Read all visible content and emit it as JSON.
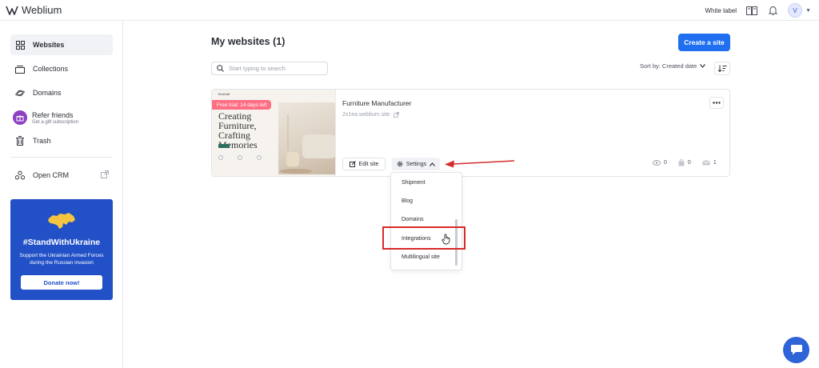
{
  "app": {
    "logo_text": "Weblium"
  },
  "topbar": {
    "white_label": "White label",
    "avatar_initial": "V"
  },
  "sidebar": {
    "items": [
      {
        "label": "Websites",
        "icon": "grid-icon",
        "active": true
      },
      {
        "label": "Collections",
        "icon": "stack-icon"
      },
      {
        "label": "Domains",
        "icon": "planet-icon"
      }
    ],
    "refer": {
      "title": "Refer friends",
      "subtitle": "Get a gift subscription"
    },
    "trash": "Trash",
    "crm": "Open CRM",
    "ukraine": {
      "tag": "#StandWithUkraine",
      "desc": "Support the Ukrainian Armed Forces during the Russian invasion",
      "donate": "Donate now!"
    }
  },
  "main": {
    "title": "My websites (1)",
    "create_button": "Create a site",
    "search_placeholder": "Start typing to search",
    "sort_label": "Sort by: Created date"
  },
  "card": {
    "thumbnail": {
      "brand": "ErraCraft",
      "trial_badge": "Free trial: 14 days left",
      "hero_text": "Creating Furniture, Crafting Memories"
    },
    "site_name": "Furniture Manufacturer",
    "site_url": "2x1ea.weblium.site",
    "edit_button": "Edit site",
    "settings_button": "Settings",
    "stats": {
      "views": "0",
      "orders": "0",
      "messages": "1"
    }
  },
  "dropdown": {
    "items": [
      "Shipment",
      "Blog",
      "Domains",
      "Integrations",
      "Multilingual site"
    ],
    "highlighted": "Integrations"
  },
  "colors": {
    "primary": "#1f6ff0",
    "ukraine_bg": "#2150c7",
    "highlight": "#d62b2b",
    "trial": "#ff6f84"
  }
}
